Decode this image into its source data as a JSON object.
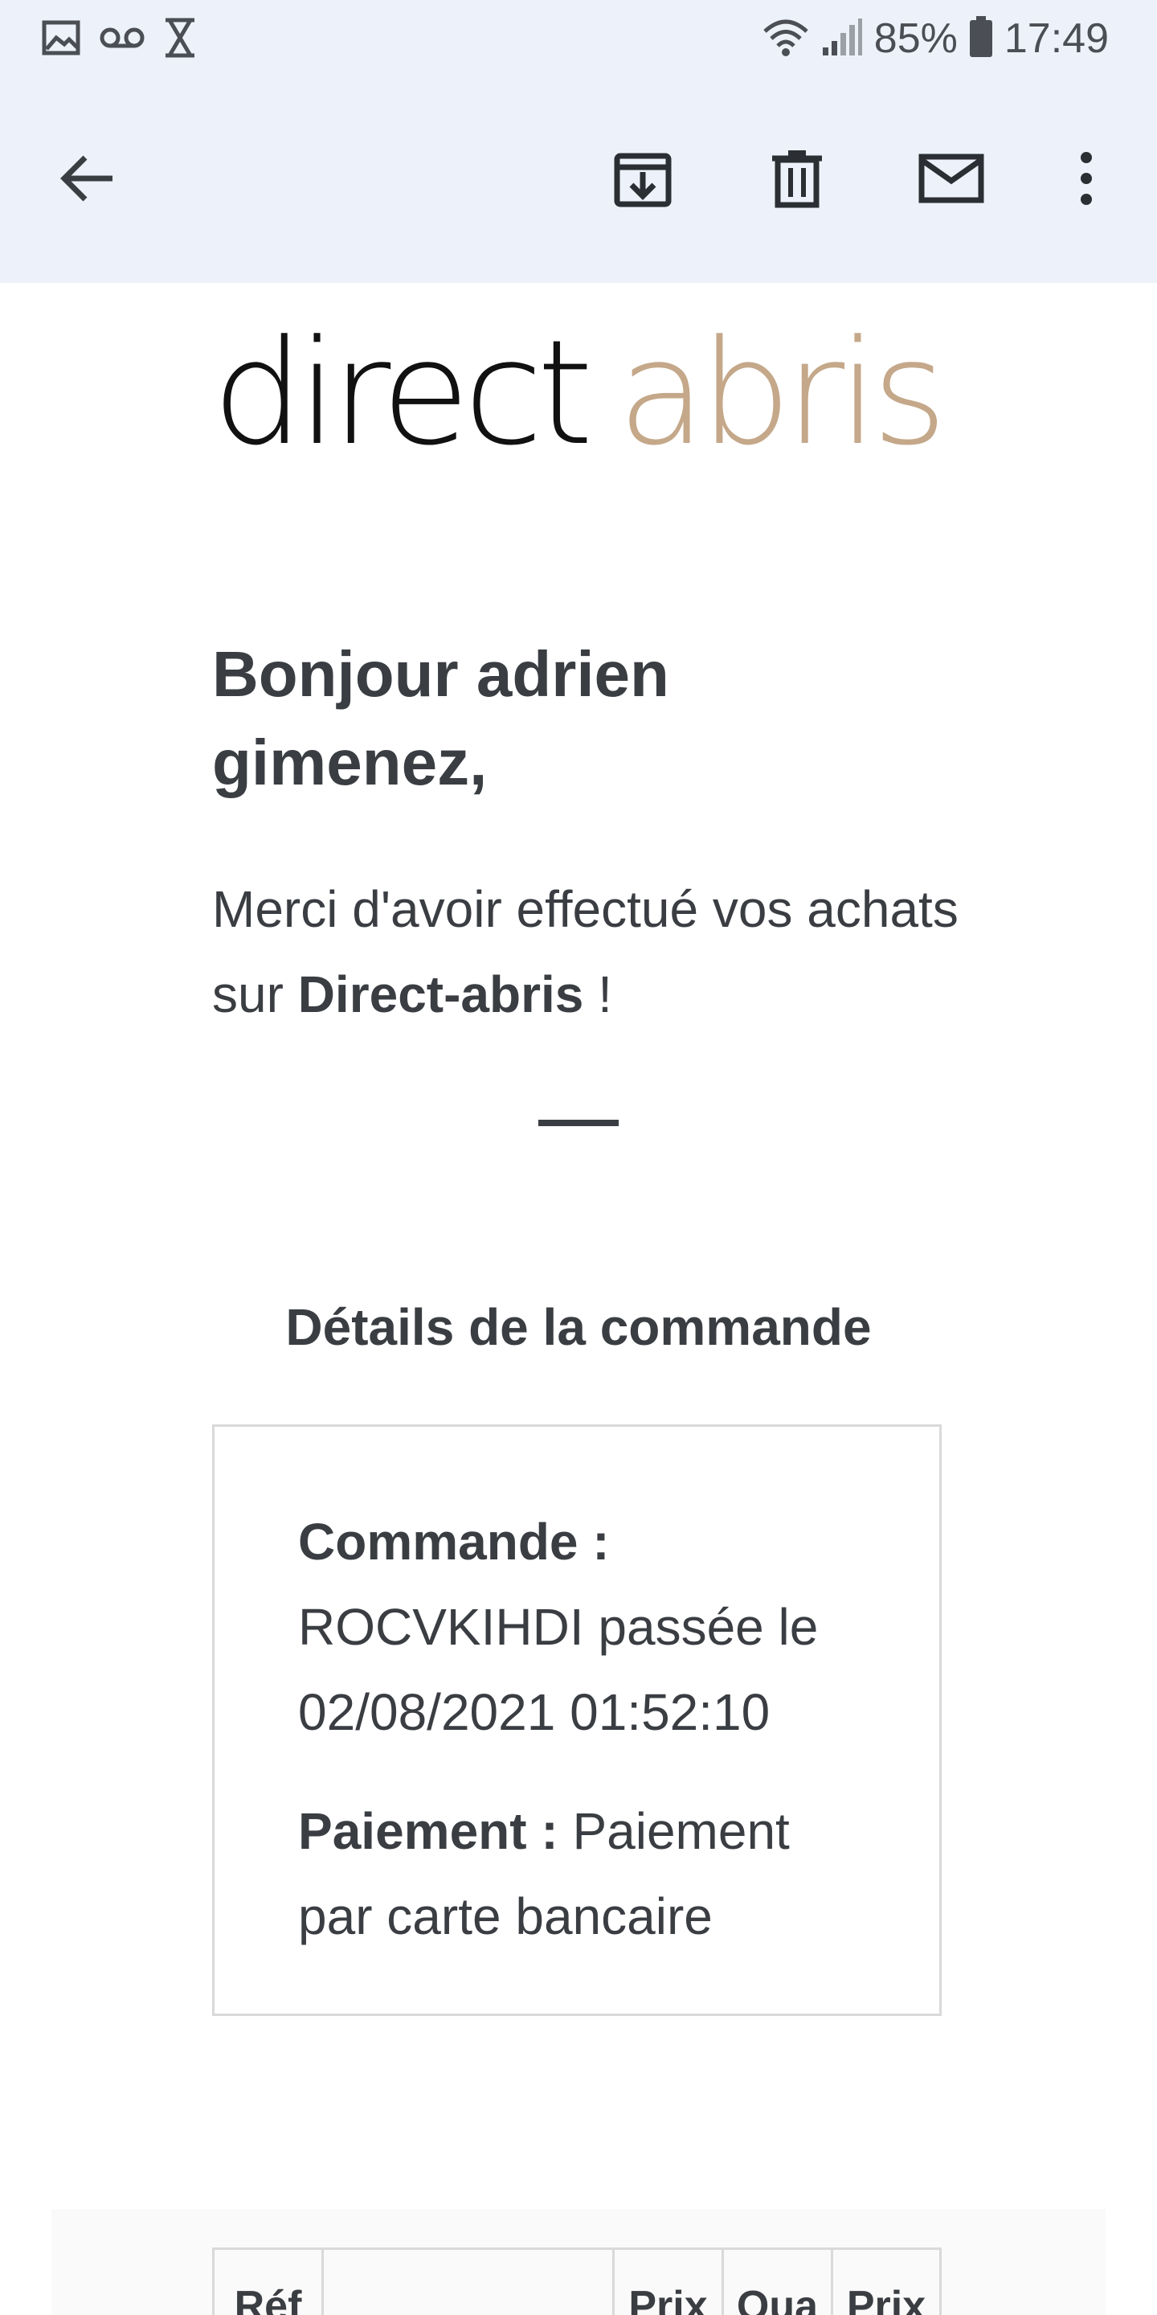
{
  "status_bar": {
    "left_icons": [
      "image-icon",
      "voicemail-icon",
      "hourglass-icon"
    ],
    "battery_percent": "85%",
    "time": "17:49"
  },
  "app_bar": {
    "icons": [
      "back-arrow-icon",
      "archive-icon",
      "trash-icon",
      "mail-icon",
      "more-vert-icon"
    ]
  },
  "email": {
    "logo": {
      "word1": "direct",
      "word2": "abris",
      "color1": "#111111",
      "color2": "#c4a889"
    },
    "greeting": "Bonjour adrien gimenez,",
    "thanks_prefix": "Merci d'avoir effectué vos achats sur ",
    "thanks_brand": "Direct-abris",
    "thanks_suffix": " !",
    "details_title": "Détails de la commande",
    "order": {
      "label": "Commande :",
      "value": "ROCVKIHDI passée le 02/08/2021 01:52:10",
      "payment_label": "Paiement :",
      "payment_value": "Paiement par carte bancaire"
    },
    "table_headers": [
      "Réf",
      "",
      "Prix",
      "Qua",
      "Prix"
    ]
  }
}
